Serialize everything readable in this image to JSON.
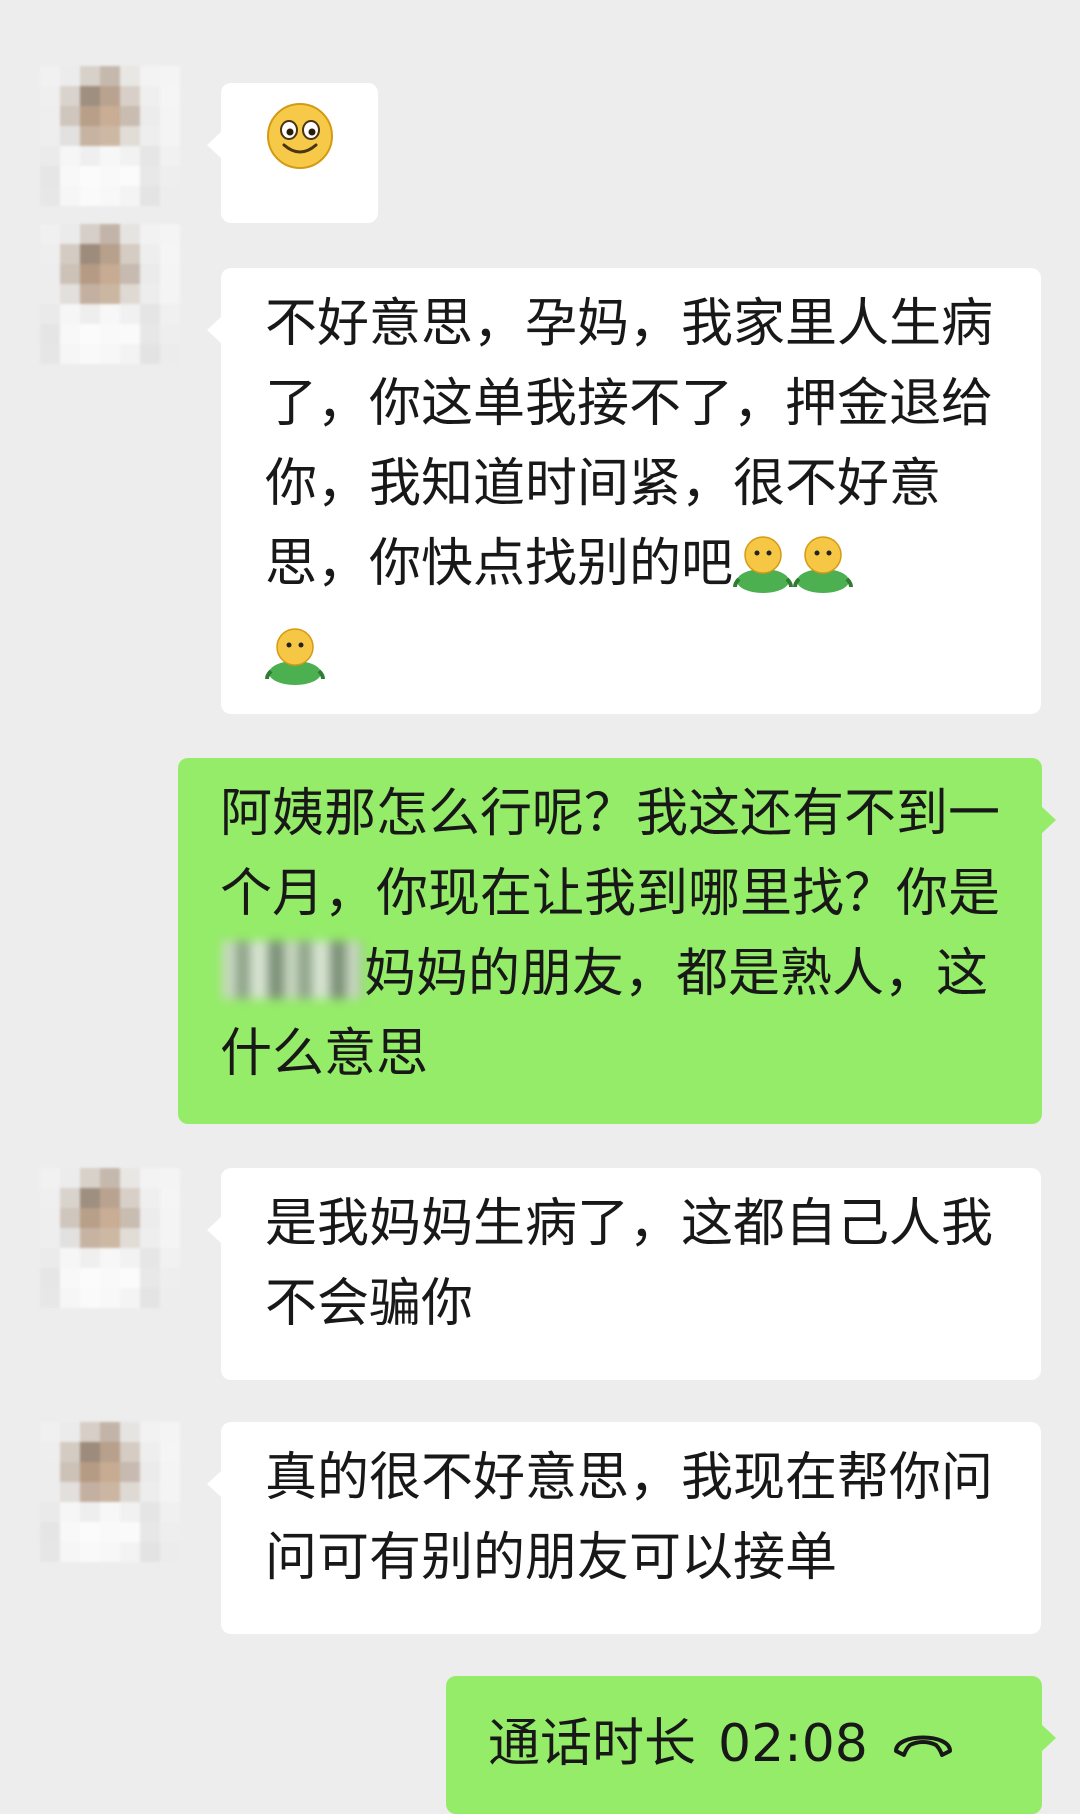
{
  "chat": {
    "messages": [
      {
        "sender": "other",
        "emoji": "smiley"
      },
      {
        "sender": "other",
        "text": "不好意思，孕妈，我家里人生病了，你这单我接不了，押金退给你，我知道时间紧，很不好意思，你快点找别的吧",
        "trailing_emojis": [
          "green-person",
          "green-person",
          "green-person"
        ]
      },
      {
        "sender": "self",
        "text_before_blur": "阿姨那怎么行呢？我这还有不到一个月，你现在让我到哪里找？你是",
        "text_after_blur": "妈妈的朋友，都是熟人，这什么意思"
      },
      {
        "sender": "other",
        "text": "是我妈妈生病了，这都自己人我不会骗你"
      },
      {
        "sender": "other",
        "text": "真的很不好意思，我现在帮你问问可有别的朋友可以接单"
      },
      {
        "sender": "self",
        "call_label": "通话时长",
        "call_duration": "02:08",
        "icon": "phone-hangup-icon"
      }
    ]
  },
  "colors": {
    "background": "#ededed",
    "incoming_bubble": "#ffffff",
    "outgoing_bubble": "#95ec69",
    "text": "#181818"
  }
}
